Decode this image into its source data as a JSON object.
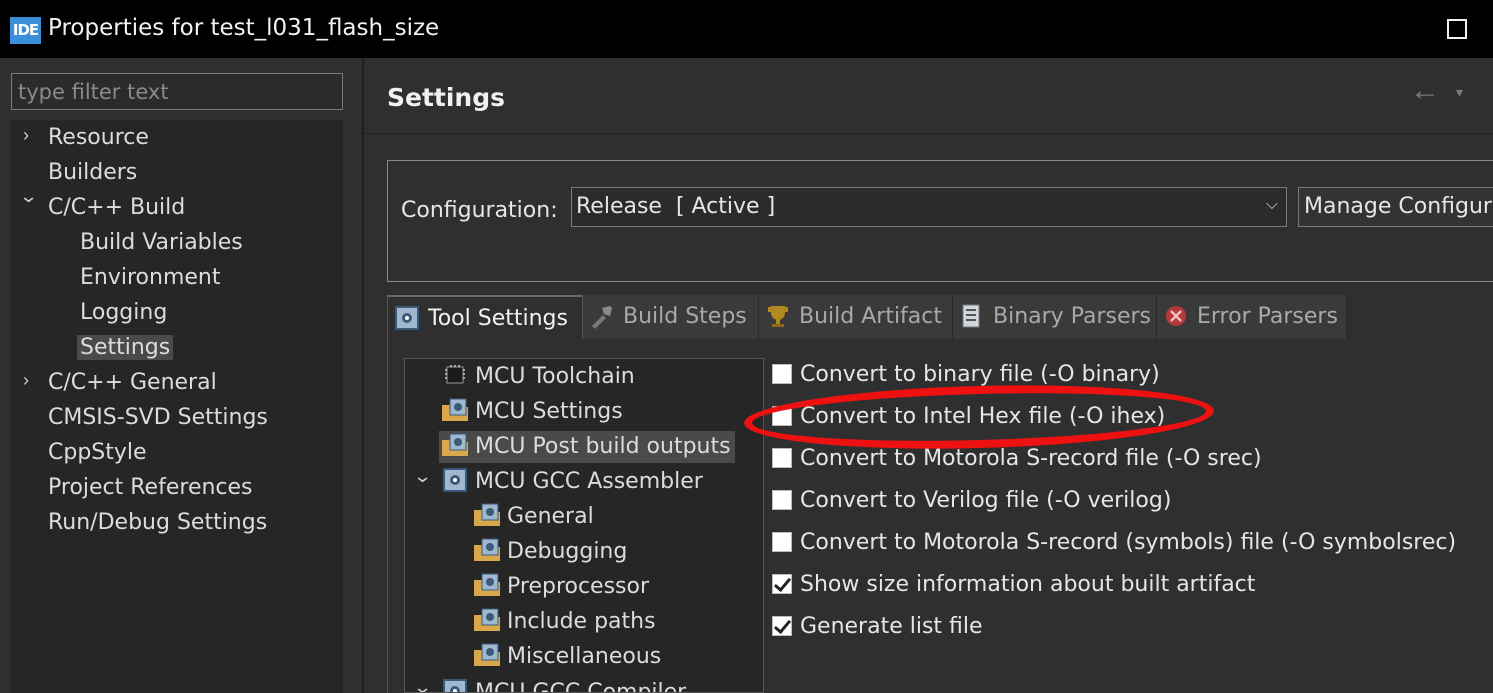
{
  "window": {
    "app_icon_text": "IDE",
    "title": "Properties for test_l031_flash_size"
  },
  "filter": {
    "placeholder": "type filter text"
  },
  "nav": {
    "items": [
      {
        "label": "Resource",
        "expander": "›"
      },
      {
        "label": "Builders"
      },
      {
        "label": "C/C++ Build",
        "expander": "⌄"
      },
      {
        "label": "Build Variables"
      },
      {
        "label": "Environment"
      },
      {
        "label": "Logging"
      },
      {
        "label": "Settings",
        "selected": true
      },
      {
        "label": "C/C++ General",
        "expander": "›"
      },
      {
        "label": "CMSIS-SVD Settings"
      },
      {
        "label": "CppStyle"
      },
      {
        "label": "Project References"
      },
      {
        "label": "Run/Debug Settings"
      }
    ]
  },
  "main": {
    "title": "Settings",
    "back_icon": "←",
    "down_icon": "▾",
    "configuration": {
      "label": "Configuration:",
      "value": "Release  [ Active ]",
      "chevron": "⌵",
      "manage_label": "Manage Configura"
    },
    "tabs": [
      {
        "label": "Tool Settings",
        "icon": "tool-settings-icon",
        "active": true
      },
      {
        "label": "Build Steps",
        "icon": "build-steps-icon"
      },
      {
        "label": "Build Artifact",
        "icon": "trophy-icon"
      },
      {
        "label": "Binary Parsers",
        "icon": "binary-parsers-icon"
      },
      {
        "label": "Error Parsers",
        "icon": "error-parsers-icon"
      }
    ],
    "tool_tree": [
      {
        "label": "MCU Toolchain",
        "icon": "chip-icon"
      },
      {
        "label": "MCU Settings",
        "icon": "folder-settings-icon"
      },
      {
        "label": "MCU Post build outputs",
        "icon": "folder-settings-icon",
        "selected": true
      },
      {
        "label": "MCU GCC Assembler",
        "icon": "tool-settings-icon",
        "expander": "⌄"
      },
      {
        "label": "General",
        "icon": "folder-settings-icon"
      },
      {
        "label": "Debugging",
        "icon": "folder-settings-icon"
      },
      {
        "label": "Preprocessor",
        "icon": "folder-settings-icon"
      },
      {
        "label": "Include paths",
        "icon": "folder-settings-icon"
      },
      {
        "label": "Miscellaneous",
        "icon": "folder-settings-icon"
      },
      {
        "label": "MCU GCC Compiler",
        "icon": "tool-settings-icon",
        "expander": "⌄"
      }
    ],
    "options": [
      {
        "label": "Convert to binary file (-O binary)",
        "checked": false
      },
      {
        "label": "Convert to Intel Hex file (-O ihex)",
        "checked": false
      },
      {
        "label": "Convert to Motorola S-record file (-O srec)",
        "checked": false
      },
      {
        "label": "Convert to Verilog file (-O verilog)",
        "checked": false
      },
      {
        "label": "Convert to Motorola S-record (symbols) file (-O symbolsrec)",
        "checked": false
      },
      {
        "label": "Show size information about built artifact",
        "checked": true
      },
      {
        "label": "Generate list file",
        "checked": true
      }
    ]
  },
  "colors": {
    "annotation_red": "#ee1111",
    "background": "#2f2f2f",
    "title_bar": "#000000"
  }
}
